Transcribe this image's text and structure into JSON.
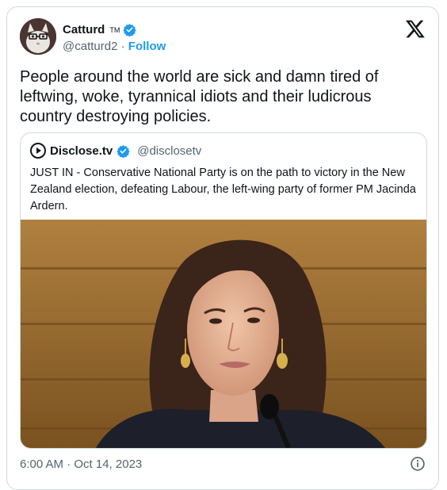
{
  "author": {
    "name": "Catturd",
    "tm": "TM",
    "handle": "@catturd2",
    "separator": " · ",
    "follow_label": "Follow"
  },
  "tweet": {
    "text": "People around the world are sick and damn tired of leftwing, woke, tyrannical idiots and their ludicrous country destroying policies."
  },
  "quoted": {
    "name": "Disclose.tv",
    "handle": "@disclosetv",
    "text": "JUST IN - Conservative National Party is on the path to victory in the New Zealand election, defeating Labour, the left-wing party of former PM Jacinda Ardern."
  },
  "footer": {
    "timestamp": "6:00 AM · Oct 14, 2023"
  },
  "icons": {
    "verified": "verified-badge-icon",
    "x_logo": "x-logo-icon",
    "info": "info-icon",
    "disclose_logo": "play-circle-icon"
  },
  "colors": {
    "accent": "#1d9bf0",
    "text": "#0f1419",
    "muted": "#536471",
    "border": "#cfd9de"
  }
}
